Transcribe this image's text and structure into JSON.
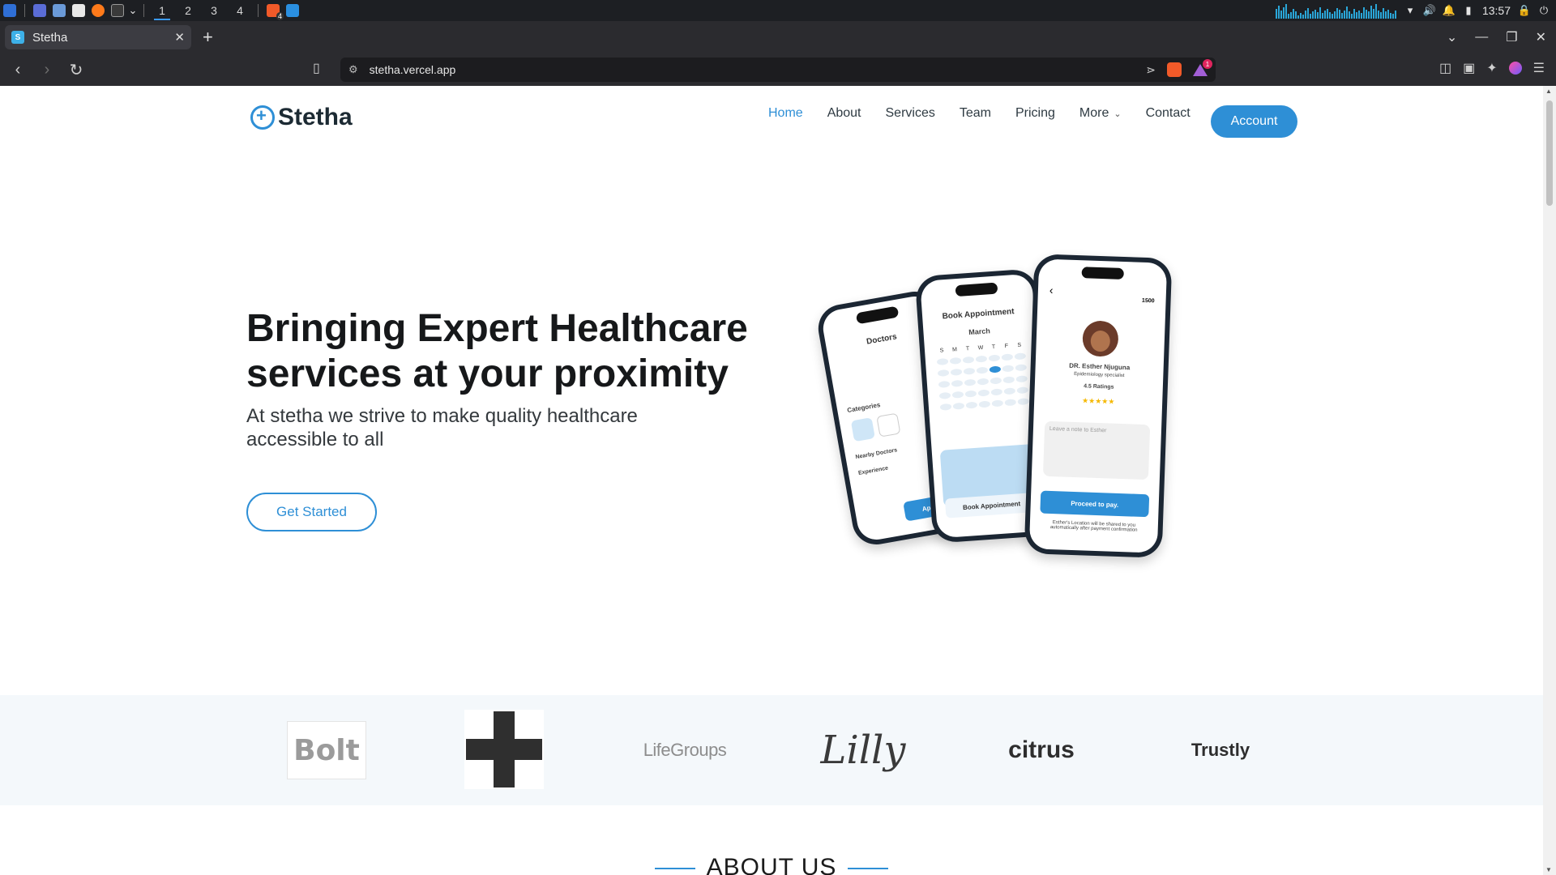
{
  "taskbar": {
    "workspaces": [
      "1",
      "2",
      "3",
      "4"
    ],
    "clock": "13:57",
    "badge_count": "4"
  },
  "browser": {
    "tab_title": "Stetha",
    "url": "stetha.vercel.app",
    "rewards_badge": "1"
  },
  "site": {
    "logo_text": "Stetha",
    "nav": {
      "home": "Home",
      "about": "About",
      "services": "Services",
      "team": "Team",
      "pricing": "Pricing",
      "more": "More",
      "contact": "Contact"
    },
    "account_label": "Account",
    "hero": {
      "title": "Bringing Expert Healthcare services at your proximity",
      "subtitle": "At stetha we strive to make quality healthcare accessible to all",
      "cta_label": "Get Started"
    },
    "phones": {
      "left": {
        "title": "Doctors",
        "categories_label": "Categories",
        "nearby_label": "Nearby Doctors",
        "experience_label": "Experience",
        "apply_label": "Apply"
      },
      "middle": {
        "title": "Book Appointment",
        "month": "March",
        "days": [
          "S",
          "M",
          "T",
          "W",
          "T",
          "F",
          "S"
        ],
        "book_label": "Book Appointment"
      },
      "right": {
        "price": "1500",
        "doctor_name": "DR. Esther Njuguna",
        "specialty": "Epidemiology specialist",
        "ratings": "4.5 Ratings",
        "note_placeholder": "Leave a note to Esther",
        "pay_label": "Proceed to pay.",
        "footnote": "Esther's Location will be shared to you automatically after payment confirmation"
      }
    },
    "partners": {
      "bolt": "Bolt",
      "lifegroups": "LifeGroups",
      "lilly": "Lilly",
      "citrus": "citrus",
      "trustly": "Trustly"
    },
    "about_heading": "ABOUT US"
  },
  "colors": {
    "accent": "#2e8fd6",
    "text_dark": "#16181a",
    "strip_bg": "#f4f8fb"
  }
}
